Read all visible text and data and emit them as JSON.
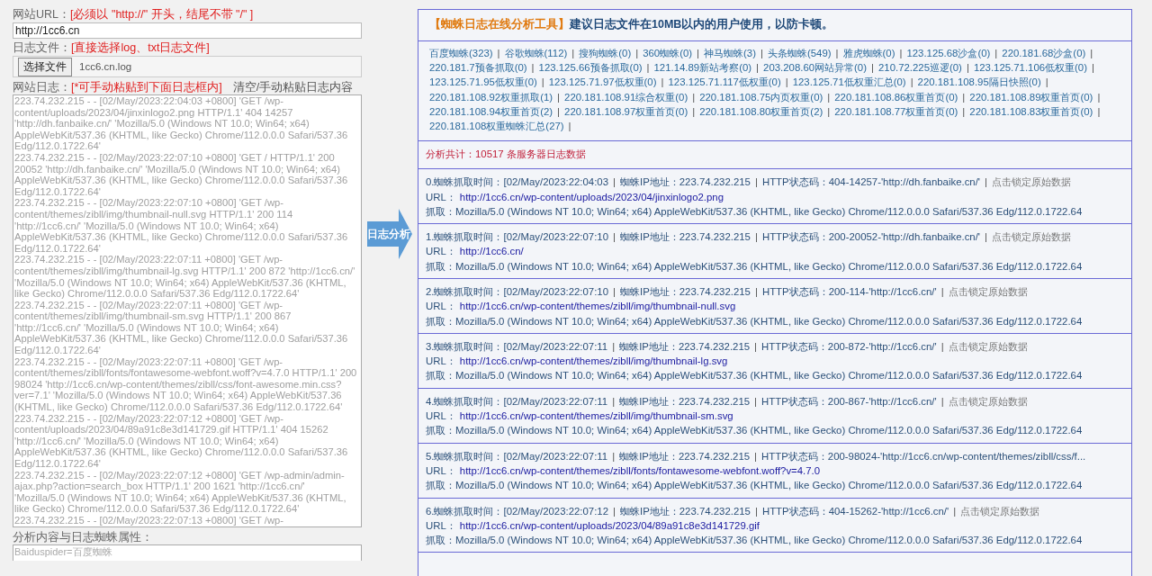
{
  "form": {
    "url_label": "网站URL：",
    "url_hint": "[必须以 \"http://\" 开头，结尾不带 \"/\" ]",
    "url_value": "http://1cc6.cn",
    "file_label": "日志文件：",
    "file_hint": "[直接选择log、txt日志文件]",
    "file_button": "选择文件",
    "file_name": "1cc6.cn.log",
    "log_label": "网站日志：",
    "log_hint": "[*可手动粘贴到下面日志框内]",
    "log_clear": "清空/手动粘贴日志内容",
    "log_lines": [
      "223.74.232.215 - - [02/May/2023:22:04:03 +0800] 'GET /wp-content/uploads/2023/04/jinxinlogo2.png HTTP/1.1' 404 14257 'http://dh.fanbaike.cn/' 'Mozilla/5.0 (Windows NT 10.0; Win64; x64) AppleWebKit/537.36 (KHTML, like Gecko) Chrome/112.0.0.0 Safari/537.36 Edg/112.0.1722.64'",
      "223.74.232.215 - - [02/May/2023:22:07:10 +0800] 'GET / HTTP/1.1' 200 20052 'http://dh.fanbaike.cn/' 'Mozilla/5.0 (Windows NT 10.0; Win64; x64) AppleWebKit/537.36 (KHTML, like Gecko) Chrome/112.0.0.0 Safari/537.36 Edg/112.0.1722.64'",
      "223.74.232.215 - - [02/May/2023:22:07:10 +0800] 'GET /wp-content/themes/zibll/img/thumbnail-null.svg HTTP/1.1' 200 114 'http://1cc6.cn/' 'Mozilla/5.0 (Windows NT 10.0; Win64; x64) AppleWebKit/537.36 (KHTML, like Gecko) Chrome/112.0.0.0 Safari/537.36 Edg/112.0.1722.64'",
      "223.74.232.215 - - [02/May/2023:22:07:11 +0800] 'GET /wp-content/themes/zibll/img/thumbnail-lg.svg HTTP/1.1' 200 872 'http://1cc6.cn/' 'Mozilla/5.0 (Windows NT 10.0; Win64; x64) AppleWebKit/537.36 (KHTML, like Gecko) Chrome/112.0.0.0 Safari/537.36 Edg/112.0.1722.64'",
      "223.74.232.215 - - [02/May/2023:22:07:11 +0800] 'GET /wp-content/themes/zibll/img/thumbnail-sm.svg HTTP/1.1' 200 867 'http://1cc6.cn/' 'Mozilla/5.0 (Windows NT 10.0; Win64; x64) AppleWebKit/537.36 (KHTML, like Gecko) Chrome/112.0.0.0 Safari/537.36 Edg/112.0.1722.64'",
      "223.74.232.215 - - [02/May/2023:22:07:11 +0800] 'GET /wp-content/themes/zibll/fonts/fontawesome-webfont.woff?v=4.7.0 HTTP/1.1' 200 98024 'http://1cc6.cn/wp-content/themes/zibll/css/font-awesome.min.css?ver=7.1' 'Mozilla/5.0 (Windows NT 10.0; Win64; x64) AppleWebKit/537.36 (KHTML, like Gecko) Chrome/112.0.0.0 Safari/537.36 Edg/112.0.1722.64'",
      "223.74.232.215 - - [02/May/2023:22:07:12 +0800] 'GET /wp-content/uploads/2023/04/89a91c8e3d141729.gif HTTP/1.1' 404 15262 'http://1cc6.cn/' 'Mozilla/5.0 (Windows NT 10.0; Win64; x64) AppleWebKit/537.36 (KHTML, like Gecko) Chrome/112.0.0.0 Safari/537.36 Edg/112.0.1722.64'",
      "223.74.232.215 - - [02/May/2023:22:07:12 +0800] 'GET /wp-admin/admin-ajax.php?action=search_box HTTP/1.1' 200 1621 'http://1cc6.cn/' 'Mozilla/5.0 (Windows NT 10.0; Win64; x64) AppleWebKit/537.36 (KHTML, like Gecko) Chrome/112.0.0.0 Safari/537.36 Edg/112.0.1722.64'",
      "223.74.232.215 - - [02/May/2023:22:07:13 +0800] 'GET /wp-"
    ],
    "attr_label": "分析内容与日志蜘蛛属性：",
    "attr_value": "Baiduspider=百度蜘蛛"
  },
  "analyze_button": "日志分析",
  "separator": "|",
  "result": {
    "tool_name": "【蜘蛛日志在线分析工具】",
    "tip": "建议日志文件在10MB以内的用户使用，以防卡顿。",
    "spiders": [
      "百度蜘蛛(323)",
      "谷歌蜘蛛(112)",
      "搜狗蜘蛛(0)",
      "360蜘蛛(0)",
      "神马蜘蛛(3)",
      "头条蜘蛛(549)",
      "雅虎蜘蛛(0)",
      "123.125.68沙盒(0)",
      "220.181.68沙盒(0)",
      "220.181.7预备抓取(0)",
      "123.125.66预备抓取(0)",
      "121.14.89新站考察(0)",
      "203.208.60网站异常(0)",
      "210.72.225巡逻(0)",
      "123.125.71.106低权重(0)",
      "123.125.71.95低权重(0)",
      "123.125.71.97低权重(0)",
      "123.125.71.117低权重(0)",
      "123.125.71低权重汇总(0)",
      "220.181.108.95隔日快照(0)",
      "220.181.108.92权重抓取(1)",
      "220.181.108.91综合权重(0)",
      "220.181.108.75内页权重(0)",
      "220.181.108.86权重首页(0)",
      "220.181.108.89权重首页(0)",
      "220.181.108.94权重首页(2)",
      "220.181.108.97权重首页(0)",
      "220.181.108.80权重首页(2)",
      "220.181.108.77权重首页(0)",
      "220.181.108.83权重首页(0)",
      "220.181.108权重蜘蛛汇总(27)"
    ],
    "total": "分析共计：10517 条服务器日志数据",
    "records": [
      {
        "time": "0.蜘蛛抓取时间：[02/May/2023:22:04:03",
        "ip": "蜘蛛IP地址：223.74.232.215",
        "status": "HTTP状态码：404-14257-'http://dh.fanbaike.cn/'",
        "lock": "点击锁定原始数据",
        "url_label": "URL：",
        "url": "http://1cc6.cn/wp-content/uploads/2023/04/jinxinlogo2.png",
        "ua": "抓取：Mozilla/5.0 (Windows NT 10.0; Win64; x64) AppleWebKit/537.36 (KHTML, like Gecko) Chrome/112.0.0.0 Safari/537.36 Edg/112.0.1722.64"
      },
      {
        "time": "1.蜘蛛抓取时间：[02/May/2023:22:07:10",
        "ip": "蜘蛛IP地址：223.74.232.215",
        "status": "HTTP状态码：200-20052-'http://dh.fanbaike.cn/'",
        "lock": "点击锁定原始数据",
        "url_label": "URL：",
        "url": "http://1cc6.cn/",
        "ua": "抓取：Mozilla/5.0 (Windows NT 10.0; Win64; x64) AppleWebKit/537.36 (KHTML, like Gecko) Chrome/112.0.0.0 Safari/537.36 Edg/112.0.1722.64"
      },
      {
        "time": "2.蜘蛛抓取时间：[02/May/2023:22:07:10",
        "ip": "蜘蛛IP地址：223.74.232.215",
        "status": "HTTP状态码：200-114-'http://1cc6.cn/'",
        "lock": "点击锁定原始数据",
        "url_label": "URL：",
        "url": "http://1cc6.cn/wp-content/themes/zibll/img/thumbnail-null.svg",
        "ua": "抓取：Mozilla/5.0 (Windows NT 10.0; Win64; x64) AppleWebKit/537.36 (KHTML, like Gecko) Chrome/112.0.0.0 Safari/537.36 Edg/112.0.1722.64"
      },
      {
        "time": "3.蜘蛛抓取时间：[02/May/2023:22:07:11",
        "ip": "蜘蛛IP地址：223.74.232.215",
        "status": "HTTP状态码：200-872-'http://1cc6.cn/'",
        "lock": "点击锁定原始数据",
        "url_label": "URL：",
        "url": "http://1cc6.cn/wp-content/themes/zibll/img/thumbnail-lg.svg",
        "ua": "抓取：Mozilla/5.0 (Windows NT 10.0; Win64; x64) AppleWebKit/537.36 (KHTML, like Gecko) Chrome/112.0.0.0 Safari/537.36 Edg/112.0.1722.64"
      },
      {
        "time": "4.蜘蛛抓取时间：[02/May/2023:22:07:11",
        "ip": "蜘蛛IP地址：223.74.232.215",
        "status": "HTTP状态码：200-867-'http://1cc6.cn/'",
        "lock": "点击锁定原始数据",
        "url_label": "URL：",
        "url": "http://1cc6.cn/wp-content/themes/zibll/img/thumbnail-sm.svg",
        "ua": "抓取：Mozilla/5.0 (Windows NT 10.0; Win64; x64) AppleWebKit/537.36 (KHTML, like Gecko) Chrome/112.0.0.0 Safari/537.36 Edg/112.0.1722.64"
      },
      {
        "time": "5.蜘蛛抓取时间：[02/May/2023:22:07:11",
        "ip": "蜘蛛IP地址：223.74.232.215",
        "status": "HTTP状态码：200-98024-'http://1cc6.cn/wp-content/themes/zibll/css/f...",
        "url_label": "URL：",
        "url": "http://1cc6.cn/wp-content/themes/zibll/fonts/fontawesome-webfont.woff?v=4.7.0",
        "ua": "抓取：Mozilla/5.0 (Windows NT 10.0; Win64; x64) AppleWebKit/537.36 (KHTML, like Gecko) Chrome/112.0.0.0 Safari/537.36 Edg/112.0.1722.64"
      },
      {
        "time": "6.蜘蛛抓取时间：[02/May/2023:22:07:12",
        "ip": "蜘蛛IP地址：223.74.232.215",
        "status": "HTTP状态码：404-15262-'http://1cc6.cn/'",
        "lock": "点击锁定原始数据",
        "url_label": "URL：",
        "url": "http://1cc6.cn/wp-content/uploads/2023/04/89a91c8e3d141729.gif",
        "ua": "抓取：Mozilla/5.0 (Windows NT 10.0; Win64; x64) AppleWebKit/537.36 (KHTML, like Gecko) Chrome/112.0.0.0 Safari/537.36 Edg/112.0.1722.64"
      }
    ]
  }
}
